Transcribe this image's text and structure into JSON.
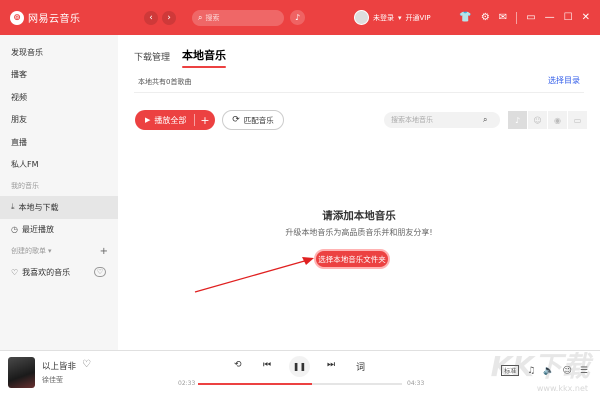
{
  "app": {
    "name": "网易云音乐",
    "logo_glyph": "⊚",
    "accent": "#ec4141"
  },
  "titlebar": {
    "search_placeholder": "搜索",
    "user_name": "未登录",
    "user_suffix": "▾",
    "vip": "开通VIP"
  },
  "sidebar": {
    "items": [
      {
        "label": "发现音乐"
      },
      {
        "label": "播客"
      },
      {
        "label": "视频"
      },
      {
        "label": "朋友"
      },
      {
        "label": "直播"
      },
      {
        "label": "私人FM"
      }
    ],
    "section_my": "我的音乐",
    "my_items": [
      {
        "label": "本地与下载",
        "icon": "download-icon",
        "glyph": "⤓"
      },
      {
        "label": "最近播放",
        "icon": "recent-icon",
        "glyph": "◷"
      }
    ],
    "section_created": "创建的歌单",
    "section_created_suffix": "▾",
    "liked": "我喜欢的音乐"
  },
  "main": {
    "tabs": [
      {
        "label": "下载管理"
      },
      {
        "label": "本地音乐"
      }
    ],
    "count_text": "本地共有0首歌曲",
    "select_dir": "选择目录",
    "play_all": "播放全部",
    "match": "匹配音乐",
    "local_search_placeholder": "搜索本地音乐",
    "empty_title": "请添加本地音乐",
    "empty_sub": "升级本地音乐为高品质音乐并和朋友分享!",
    "choose_button": "选择本地音乐文件夹"
  },
  "player": {
    "song": "以上皆非",
    "artist": "徐佳莹",
    "time_current": "02:33",
    "time_total": "04:33",
    "progress": 0.56,
    "lyric": "词",
    "quality": "标准"
  },
  "watermark": {
    "text": "KK下载",
    "url": "www.kkx.net"
  }
}
